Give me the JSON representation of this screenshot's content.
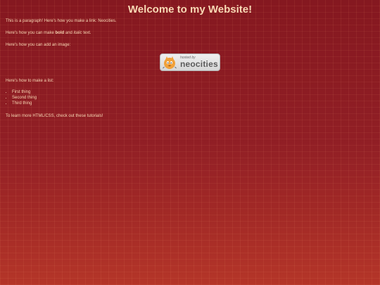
{
  "title": "Welcome to my Website!",
  "paragraph1": {
    "prefix": "This is a paragraph! Here's how you make a link: ",
    "link_text": "Neocities",
    "suffix": "."
  },
  "paragraph2": {
    "prefix": "Here's how you can make ",
    "bold_text": "bold",
    "middle": " and ",
    "italic_text": "italic",
    "suffix": " text."
  },
  "paragraph3": "Here's how you can add an image:",
  "badge": {
    "small_text": "hosted by",
    "big_text": "neocities"
  },
  "paragraph4": "Here's how to make a list:",
  "list_items": [
    "First thing",
    "Second thing",
    "Third thing"
  ],
  "paragraph5": {
    "prefix": "To learn more HTML/CSS, check out these ",
    "link_text": "tutorials",
    "suffix": "!"
  },
  "colors": {
    "background": "#8e1b22",
    "text": "#f8d8b4",
    "badge_background": "#d6d6d6"
  },
  "icons": {
    "badge_mascot": "cat-mascot-icon"
  }
}
